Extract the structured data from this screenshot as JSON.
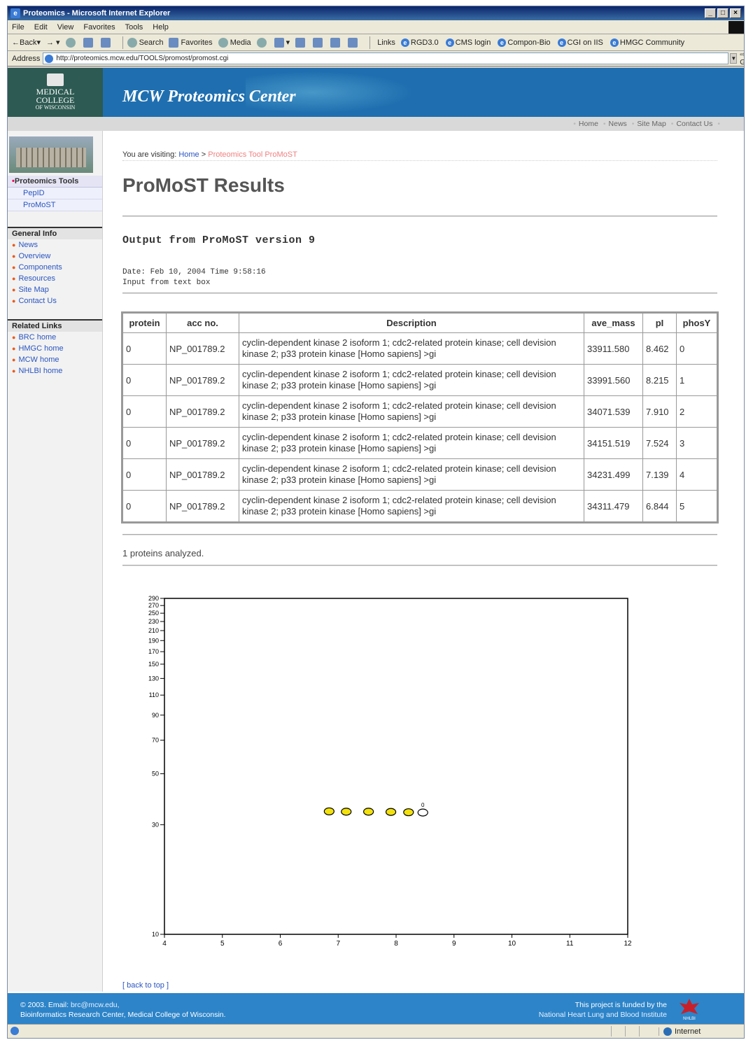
{
  "window": {
    "title": "Proteomics - Microsoft Internet Explorer",
    "controls": [
      "_",
      "□",
      "×"
    ]
  },
  "menu": [
    "File",
    "Edit",
    "View",
    "Favorites",
    "Tools",
    "Help"
  ],
  "toolbar": {
    "back": "Back",
    "search": "Search",
    "favorites": "Favorites",
    "media": "Media",
    "links_label": "Links",
    "links": [
      "RGD3.0",
      "CMS login",
      "Compon-Bio",
      "CGI on IIS",
      "HMGC Community"
    ]
  },
  "address": {
    "label": "Address",
    "url": "http://proteomics.mcw.edu/TOOLS/promost/promost.cgi",
    "go": "Go"
  },
  "banner": {
    "logo": [
      "MEDICAL",
      "COLLEGE",
      "OF WISCONSIN"
    ],
    "title": "MCW Proteomics Center"
  },
  "subnav": [
    "Home",
    "News",
    "Site Map",
    "Contact Us"
  ],
  "sidebar": {
    "proteomics_tools": "Proteomics Tools",
    "tools": [
      "PepID",
      "ProMoST"
    ],
    "general_info": "General Info",
    "general_items": [
      "News",
      "Overview",
      "Components",
      "Resources",
      "Site Map",
      "Contact Us"
    ],
    "related_links": "Related Links",
    "related_items": [
      "BRC home",
      "HMGC home",
      "MCW home",
      "NHLBI home"
    ]
  },
  "breadcrumb": {
    "prefix": "You are visiting:",
    "home": "Home",
    "sep": ">",
    "current": "Proteomics Tool ProMoST"
  },
  "heading": "ProMoST Results",
  "output_title": "Output from ProMoST version 9",
  "meta": {
    "date_line": "Date: Feb 10, 2004 Time 9:58:16",
    "input_line": "Input from text box"
  },
  "table": {
    "headers": [
      "protein",
      "acc no.",
      "Description",
      "ave_mass",
      "pI",
      "phosY"
    ],
    "rows": [
      [
        "0",
        "NP_001789.2",
        "cyclin-dependent kinase 2 isoform 1; cdc2-related protein kinase; cell devision kinase 2; p33 protein kinase [Homo sapiens] >gi",
        "33911.580",
        "8.462",
        "0"
      ],
      [
        "0",
        "NP_001789.2",
        "cyclin-dependent kinase 2 isoform 1; cdc2-related protein kinase; cell devision kinase 2; p33 protein kinase [Homo sapiens] >gi",
        "33991.560",
        "8.215",
        "1"
      ],
      [
        "0",
        "NP_001789.2",
        "cyclin-dependent kinase 2 isoform 1; cdc2-related protein kinase; cell devision kinase 2; p33 protein kinase [Homo sapiens] >gi",
        "34071.539",
        "7.910",
        "2"
      ],
      [
        "0",
        "NP_001789.2",
        "cyclin-dependent kinase 2 isoform 1; cdc2-related protein kinase; cell devision kinase 2; p33 protein kinase [Homo sapiens] >gi",
        "34151.519",
        "7.524",
        "3"
      ],
      [
        "0",
        "NP_001789.2",
        "cyclin-dependent kinase 2 isoform 1; cdc2-related protein kinase; cell devision kinase 2; p33 protein kinase [Homo sapiens] >gi",
        "34231.499",
        "7.139",
        "4"
      ],
      [
        "0",
        "NP_001789.2",
        "cyclin-dependent kinase 2 isoform 1; cdc2-related protein kinase; cell devision kinase 2; p33 protein kinase [Homo sapiens] >gi",
        "34311.479",
        "6.844",
        "5"
      ]
    ]
  },
  "analyzed": "1 proteins analyzed.",
  "chart_data": {
    "type": "scatter",
    "x_ticks": [
      4,
      5,
      6,
      7,
      8,
      9,
      10,
      11,
      12
    ],
    "y_ticks": [
      10,
      30,
      50,
      70,
      90,
      110,
      130,
      150,
      170,
      190,
      210,
      230,
      250,
      270,
      290
    ],
    "xlim": [
      4,
      12
    ],
    "ylim": [
      10,
      290
    ],
    "y_scale": "log",
    "marker_label": "0",
    "points": [
      {
        "x": 6.844,
        "y": 34.3,
        "fill": "#f2e10c"
      },
      {
        "x": 7.139,
        "y": 34.2,
        "fill": "#f2e10c"
      },
      {
        "x": 7.524,
        "y": 34.2,
        "fill": "#f2e10c"
      },
      {
        "x": 7.91,
        "y": 34.1,
        "fill": "#f2e10c"
      },
      {
        "x": 8.215,
        "y": 34.0,
        "fill": "#f2e10c"
      },
      {
        "x": 8.462,
        "y": 33.9,
        "fill": "#ffffff"
      }
    ]
  },
  "back_to_top": "[ back to top ]",
  "footer": {
    "line1_prefix": "© 2003. Email:",
    "email": "brc@mcw.edu,",
    "line2": "Bioinformatics Research Center, Medical College of Wisconsin.",
    "funded": "This project is funded by the",
    "nhlbi": "National Heart Lung and Blood Institute",
    "badge": "NHLBI"
  },
  "status": {
    "zone": "Internet"
  },
  "colors": {
    "banner": "#1f6fb0",
    "footer": "#2d84c8",
    "link": "#2a55c0",
    "bullet": "#e85a1e",
    "spot": "#f2e10c"
  }
}
